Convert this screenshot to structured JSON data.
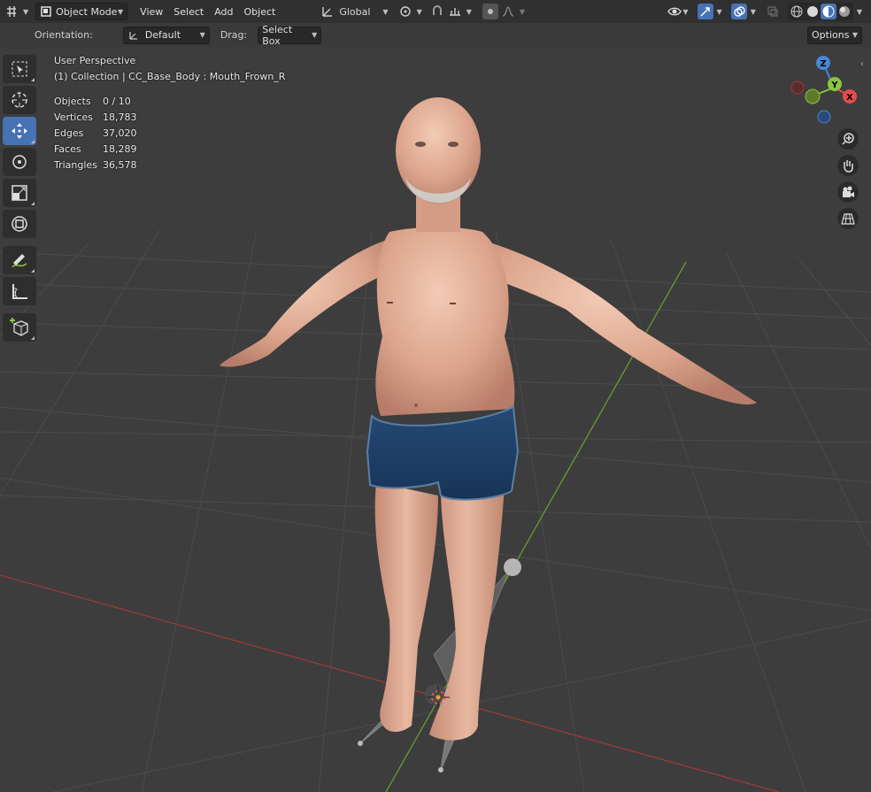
{
  "header": {
    "mode_label": "Object Mode",
    "menus": [
      "View",
      "Select",
      "Add",
      "Object"
    ],
    "transform_orientation": "Global"
  },
  "tool_settings": {
    "orientation_label": "Orientation:",
    "orientation_value": "Default",
    "drag_label": "Drag:",
    "drag_value": "Select Box",
    "options_label": "Options"
  },
  "viewport": {
    "view_name": "User Perspective",
    "context": "(1) Collection | CC_Base_Body : Mouth_Frown_R",
    "stats": [
      {
        "label": "Objects",
        "value": "0 / 10"
      },
      {
        "label": "Vertices",
        "value": "18,783"
      },
      {
        "label": "Edges",
        "value": "37,020"
      },
      {
        "label": "Faces",
        "value": "18,289"
      },
      {
        "label": "Triangles",
        "value": "36,578"
      }
    ]
  },
  "gizmo": {
    "x_label": "X",
    "y_label": "Y",
    "z_label": "Z"
  },
  "colors": {
    "accent": "#4772b3",
    "axis_x": "#e44d4d",
    "axis_y": "#8cc43e",
    "axis_z": "#4a86d6"
  },
  "tools": [
    "select-box-icon",
    "cursor-icon",
    "move-icon",
    "rotate-icon",
    "scale-icon",
    "transform-icon",
    "annotate-icon",
    "measure-icon",
    "add-cube-icon"
  ]
}
